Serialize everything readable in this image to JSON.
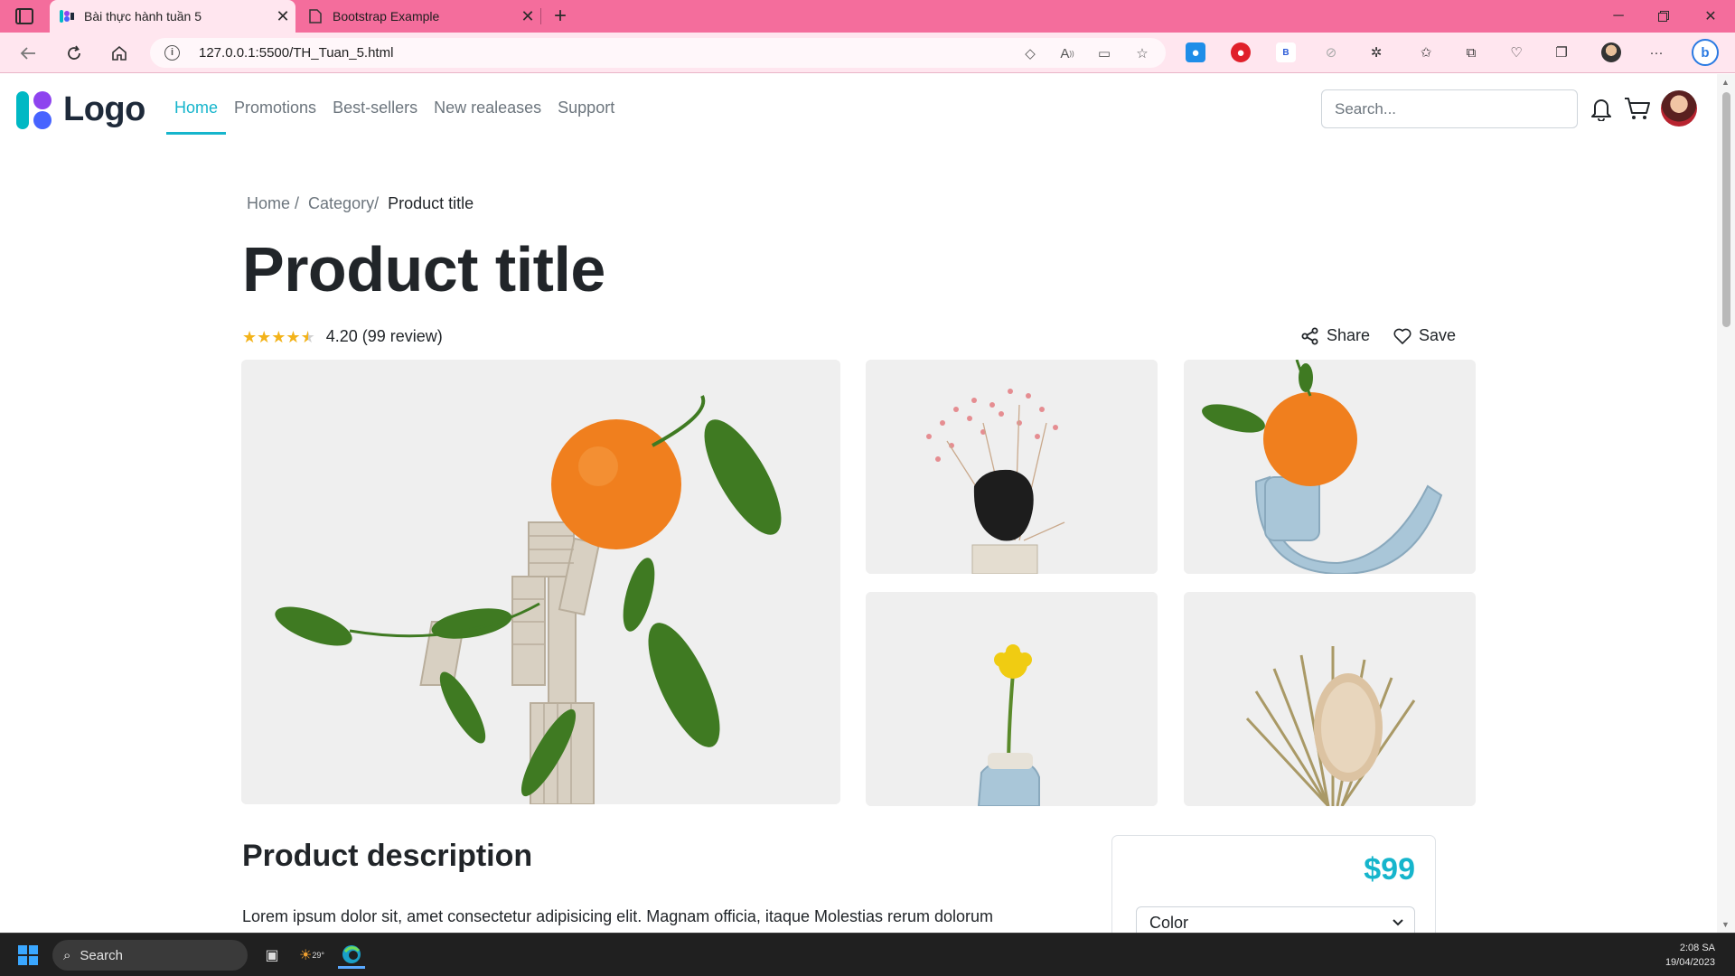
{
  "browser": {
    "tabs": [
      {
        "title": "Bài thực hành tuần 5",
        "active": true
      },
      {
        "title": "Bootstrap Example",
        "active": false
      }
    ],
    "url": "127.0.0.1:5500/TH_Tuan_5.html"
  },
  "site": {
    "logo_text": "Logo",
    "nav": [
      "Home",
      "Promotions",
      "Best-sellers",
      "New realeases",
      "Support"
    ],
    "search_placeholder": "Search..."
  },
  "breadcrumb": [
    "Home /",
    "Category/",
    "Product title"
  ],
  "product": {
    "title": "Product title",
    "rating": 4.2,
    "rating_text": "4.20 (99 review)",
    "share_label": "Share",
    "save_label": "Save",
    "description_title": "Product description",
    "description_text": "Lorem ipsum dolor sit, amet consectetur adipisicing elit. Magnam officia, itaque Molestias rerum dolorum",
    "price": "$99",
    "color_label": "Color"
  },
  "colors": {
    "browser_tabbar": "#f46d9c",
    "browser_toolbar": "#ffe6ef",
    "accent": "#16b5cc",
    "star": "#f3b31a",
    "text": "#212529",
    "muted": "#6c757d"
  },
  "taskbar": {
    "search_label": "Search",
    "weather": "29°",
    "time": "2:08 SA",
    "date": "19/04/2023"
  }
}
